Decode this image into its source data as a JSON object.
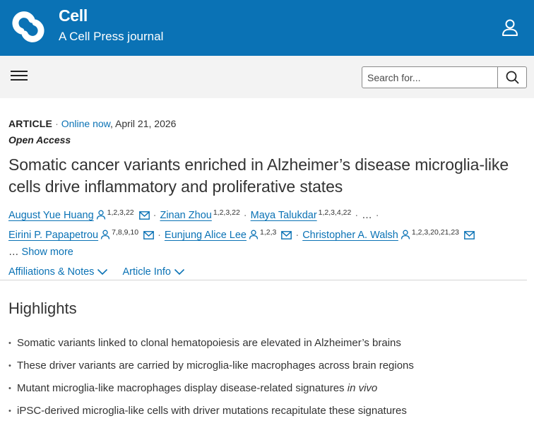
{
  "header": {
    "brand": "Cell",
    "tagline": "A Cell Press journal"
  },
  "search": {
    "placeholder": "Search for..."
  },
  "article": {
    "type": "ARTICLE",
    "online_label": "Online now",
    "date": "April 21, 2026",
    "access": "Open Access",
    "title": "Somatic cancer variants enriched in Alzheimer’s disease microglia-like cells drive inflammatory and proliferative states",
    "authors": [
      {
        "name": "August Yue Huang",
        "affiliations": "1,2,3,22"
      },
      {
        "name": "Zinan Zhou",
        "affiliations": "1,2,3,22"
      },
      {
        "name": "Maya Talukdar",
        "affiliations": "1,2,3,4,22"
      },
      {
        "name": "Eirini P. Papapetrou",
        "affiliations": "7,8,9,10"
      },
      {
        "name": "Eunjung Alice Lee",
        "affiliations": "1,2,3"
      },
      {
        "name": "Christopher A. Walsh",
        "affiliations": "1,2,3,20,21,23"
      }
    ],
    "ellipsis": "…",
    "show_more": "Show more",
    "tabs": [
      {
        "label": "Affiliations & Notes"
      },
      {
        "label": "Article Info"
      }
    ]
  },
  "highlights": {
    "title": "Highlights",
    "items": [
      "Somatic variants linked to clonal hematopoiesis are elevated in Alzheimer’s brains",
      "These driver variants are carried by microglia-like macrophages across brain regions",
      "Mutant microglia-like macrophages display disease-related signatures",
      "iPSC-derived microglia-like cells with driver mutations recapitulate these signatures"
    ],
    "item3_emphasis": "in vivo"
  },
  "colors": {
    "brand_blue": "#0a72b5",
    "search_bar_bg": "#f3f3f3",
    "text": "#333333"
  },
  "icons": [
    "cell-logo-icon",
    "user-icon",
    "hamburger-menu-icon",
    "search-icon",
    "person-icon",
    "mail-icon",
    "chevron-down-icon"
  ]
}
